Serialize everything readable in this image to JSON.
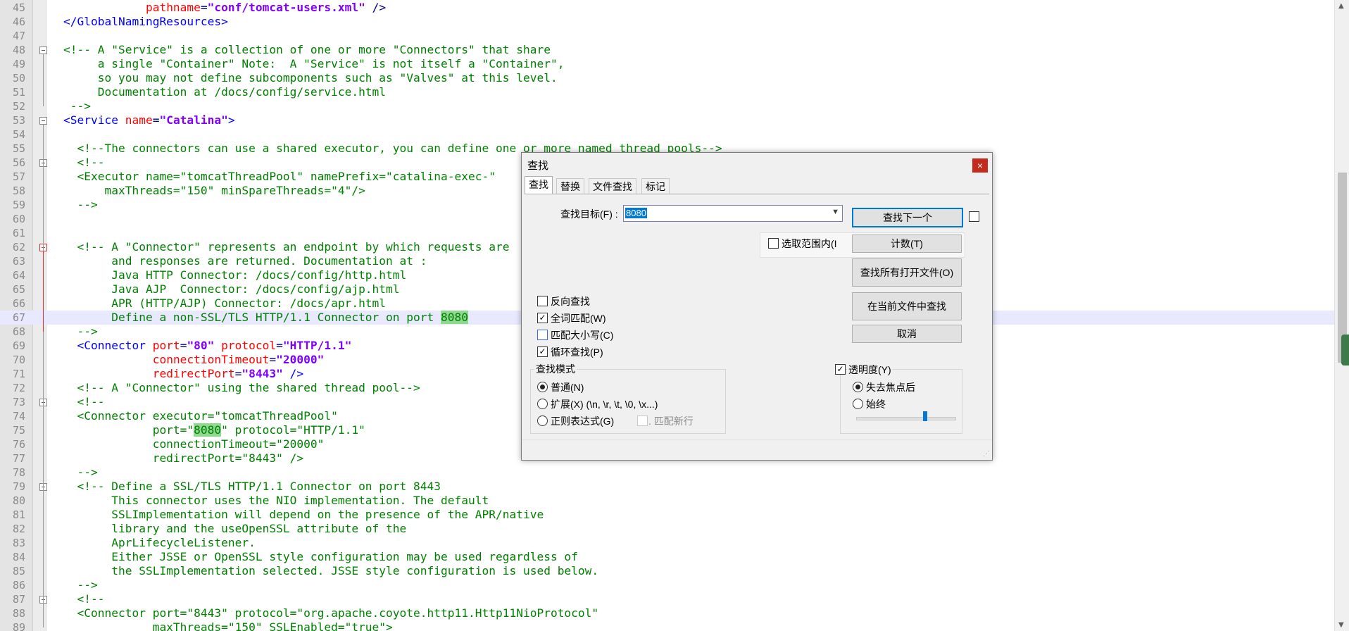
{
  "editor": {
    "lines": [
      {
        "n": "45",
        "segs": [
          [
            "",
            "            "
          ],
          [
            "an",
            "pathname"
          ],
          [
            "",
            "="
          ],
          [
            "av",
            "\"conf/tomcat-users.xml\""
          ],
          [
            "",
            " />"
          ]
        ]
      },
      {
        "n": "46",
        "segs": [
          [
            "tg",
            "</GlobalNamingResources>"
          ]
        ]
      },
      {
        "n": "47",
        "segs": []
      },
      {
        "n": "48",
        "segs": [
          [
            "cm",
            "<!-- A \"Service\" is a collection of one or more \"Connectors\" that share"
          ]
        ]
      },
      {
        "n": "49",
        "segs": [
          [
            "cm",
            "     a single \"Container\" Note:  A \"Service\" is not itself a \"Container\","
          ]
        ]
      },
      {
        "n": "50",
        "segs": [
          [
            "cm",
            "     so you may not define subcomponents such as \"Valves\" at this level."
          ]
        ]
      },
      {
        "n": "51",
        "segs": [
          [
            "cm",
            "     Documentation at /docs/config/service.html"
          ]
        ]
      },
      {
        "n": "52",
        "segs": [
          [
            "cm",
            " -->"
          ]
        ]
      },
      {
        "n": "53",
        "segs": [
          [
            "tg",
            "<Service "
          ],
          [
            "an",
            "name"
          ],
          [
            "",
            "="
          ],
          [
            "av",
            "\"Catalina\""
          ],
          [
            "tg",
            ">"
          ]
        ]
      },
      {
        "n": "54",
        "segs": []
      },
      {
        "n": "55",
        "segs": [
          [
            "cm",
            "  <!--The connectors can use a shared executor, you can define one or more named thread pools-->"
          ]
        ]
      },
      {
        "n": "56",
        "segs": [
          [
            "cm",
            "  <!--"
          ]
        ]
      },
      {
        "n": "57",
        "segs": [
          [
            "cm",
            "  <Executor name=\"tomcatThreadPool\" namePrefix=\"catalina-exec-\""
          ]
        ]
      },
      {
        "n": "58",
        "segs": [
          [
            "cm",
            "      maxThreads=\"150\" minSpareThreads=\"4\"/>"
          ]
        ]
      },
      {
        "n": "59",
        "segs": [
          [
            "cm",
            "  -->"
          ]
        ]
      },
      {
        "n": "60",
        "segs": []
      },
      {
        "n": "61",
        "segs": []
      },
      {
        "n": "62",
        "segs": [
          [
            "cm",
            "  <!-- A \"Connector\" represents an endpoint by which requests are"
          ]
        ]
      },
      {
        "n": "63",
        "segs": [
          [
            "cm",
            "       and responses are returned. Documentation at :"
          ]
        ]
      },
      {
        "n": "64",
        "segs": [
          [
            "cm",
            "       Java HTTP Connector: /docs/config/http.html"
          ]
        ]
      },
      {
        "n": "65",
        "segs": [
          [
            "cm",
            "       Java AJP  Connector: /docs/config/ajp.html"
          ]
        ]
      },
      {
        "n": "66",
        "segs": [
          [
            "cm",
            "       APR (HTTP/AJP) Connector: /docs/apr.html"
          ]
        ]
      },
      {
        "n": "67",
        "segs": [
          [
            "cm",
            "       Define a non-SSL/TLS HTTP/1.1 Connector on port "
          ],
          [
            "cm hl",
            "8080"
          ]
        ],
        "current": true
      },
      {
        "n": "68",
        "segs": [
          [
            "cm",
            "  -->"
          ]
        ]
      },
      {
        "n": "69",
        "segs": [
          [
            "tg",
            "  <Connector "
          ],
          [
            "an",
            "port"
          ],
          [
            "",
            "="
          ],
          [
            "av",
            "\"80\""
          ],
          [
            "",
            " "
          ],
          [
            "an",
            "protocol"
          ],
          [
            "",
            "="
          ],
          [
            "av",
            "\"HTTP/1.1\""
          ]
        ]
      },
      {
        "n": "70",
        "segs": [
          [
            "",
            "             "
          ],
          [
            "an",
            "connectionTimeout"
          ],
          [
            "",
            "="
          ],
          [
            "av",
            "\"20000\""
          ]
        ]
      },
      {
        "n": "71",
        "segs": [
          [
            "",
            "             "
          ],
          [
            "an",
            "redirectPort"
          ],
          [
            "",
            "="
          ],
          [
            "av",
            "\"8443\""
          ],
          [
            "tg",
            " />"
          ]
        ]
      },
      {
        "n": "72",
        "segs": [
          [
            "cm",
            "  <!-- A \"Connector\" using the shared thread pool-->"
          ]
        ]
      },
      {
        "n": "73",
        "segs": [
          [
            "cm",
            "  <!--"
          ]
        ]
      },
      {
        "n": "74",
        "segs": [
          [
            "cm",
            "  <Connector executor=\"tomcatThreadPool\""
          ]
        ]
      },
      {
        "n": "75",
        "segs": [
          [
            "cm",
            "             port=\""
          ],
          [
            "cm hl",
            "8080"
          ],
          [
            "cm",
            "\" protocol=\"HTTP/1.1\""
          ]
        ]
      },
      {
        "n": "76",
        "segs": [
          [
            "cm",
            "             connectionTimeout=\"20000\""
          ]
        ]
      },
      {
        "n": "77",
        "segs": [
          [
            "cm",
            "             redirectPort=\"8443\" />"
          ]
        ]
      },
      {
        "n": "78",
        "segs": [
          [
            "cm",
            "  -->"
          ]
        ]
      },
      {
        "n": "79",
        "segs": [
          [
            "cm",
            "  <!-- Define a SSL/TLS HTTP/1.1 Connector on port 8443"
          ]
        ]
      },
      {
        "n": "80",
        "segs": [
          [
            "cm",
            "       This connector uses the NIO implementation. The default"
          ]
        ]
      },
      {
        "n": "81",
        "segs": [
          [
            "cm",
            "       SSLImplementation will depend on the presence of the APR/native"
          ]
        ]
      },
      {
        "n": "82",
        "segs": [
          [
            "cm",
            "       library and the useOpenSSL attribute of the"
          ]
        ]
      },
      {
        "n": "83",
        "segs": [
          [
            "cm",
            "       AprLifecycleListener."
          ]
        ]
      },
      {
        "n": "84",
        "segs": [
          [
            "cm",
            "       Either JSSE or OpenSSL style configuration may be used regardless of"
          ]
        ]
      },
      {
        "n": "85",
        "segs": [
          [
            "cm",
            "       the SSLImplementation selected. JSSE style configuration is used below."
          ]
        ]
      },
      {
        "n": "86",
        "segs": [
          [
            "cm",
            "  -->"
          ]
        ]
      },
      {
        "n": "87",
        "segs": [
          [
            "cm",
            "  <!--"
          ]
        ]
      },
      {
        "n": "88",
        "segs": [
          [
            "cm",
            "  <Connector port=\"8443\" protocol=\"org.apache.coyote.http11.Http11NioProtocol\""
          ]
        ]
      },
      {
        "n": "89",
        "segs": [
          [
            "cm",
            "             maxThreads=\"150\" SSLEnabled=\"true\">"
          ]
        ]
      }
    ],
    "fold_lines": [
      "48",
      "53",
      "56",
      "62",
      "73",
      "79",
      "87"
    ],
    "fold_red": [
      "62"
    ]
  },
  "dialog": {
    "title": "查找",
    "close": "×",
    "tabs": [
      "查找",
      "替换",
      "文件查找",
      "标记"
    ],
    "active_tab": 0,
    "target_label": "查找目标(F) :",
    "target_value": "8080",
    "in_selection_label": "选取范围内(I",
    "buttons": {
      "find_next": "查找下一个",
      "count": "计数(T)",
      "find_all_open": "查找所有打开文件(O)",
      "find_in_current": "在当前文件中查找",
      "cancel": "取消"
    },
    "options": {
      "backward": "反向查找",
      "whole_word": "全词匹配(W)",
      "match_case": "匹配大小写(C)",
      "wrap": "循环查找(P)"
    },
    "mode": {
      "title": "查找模式",
      "normal": "普通(N)",
      "extended": "扩展(X) (\\n, \\r, \\t, \\0, \\x...)",
      "regex": "正则表达式(G)",
      "newline": ". 匹配新行"
    },
    "transparency": {
      "title": "透明度(Y)",
      "on_lose_focus": "失去焦点后",
      "always": "始终",
      "level": 0.7
    }
  }
}
